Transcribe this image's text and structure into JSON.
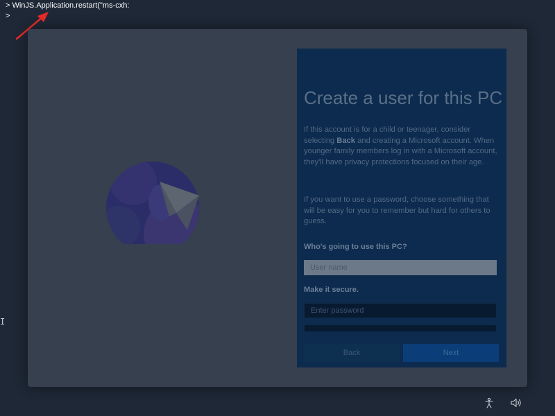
{
  "console": {
    "line1": "> WinJS.Application.restart(\"ms-cxh:",
    "line2": ">"
  },
  "colors": {
    "annotation_arrow": "#e82a2a",
    "panel_bg": "#0c2b4e",
    "window_bg": "#36404e"
  },
  "oobe": {
    "title": "Create a user for this PC",
    "para1": {
      "before": "If this account is for a child or teenager, consider selecting ",
      "bold": "Back",
      "after": " and creating a Microsoft account. When younger family members log in with a Microsoft account, they'll have privacy protections focused on their age."
    },
    "para2": "If you want to use a password, choose something that will be easy for you to remember but hard for others to guess.",
    "who_label": "Who's going to use this PC?",
    "username_placeholder": "User name",
    "secure_label": "Make it secure.",
    "password_placeholder": "Enter password",
    "back_label": "Back",
    "next_label": "Next"
  },
  "taskbar": {
    "icons": [
      "accessibility-icon",
      "speaker-icon"
    ]
  }
}
